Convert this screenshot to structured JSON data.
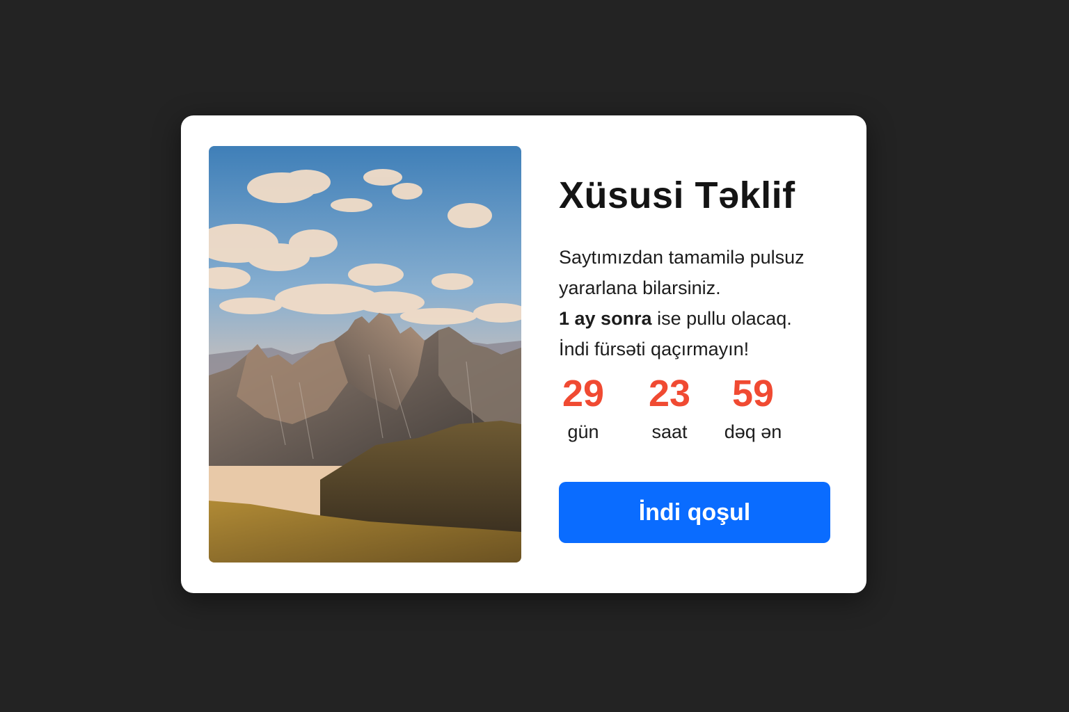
{
  "offer": {
    "title": "Xüsusi Təklif",
    "desc_line1": "Saytımızdan tamamilə pulsuz",
    "desc_line2": "yararlana bilarsiniz.",
    "desc_line3_bold": "1 ay sonra",
    "desc_line3_rest": " ise pullu olacaq.",
    "desc_line4": "İndi fürsəti qaçırmayın!",
    "countdown": [
      {
        "value": "29",
        "label": "gün"
      },
      {
        "value": "23",
        "label": "saat"
      },
      {
        "value": "59",
        "label": "dəq ən"
      }
    ],
    "cta_label": "İndi qoşul"
  },
  "image": {
    "subject": "mountain-landscape"
  },
  "colors": {
    "background": "#232323",
    "card": "#ffffff",
    "countdown": "#f04a32",
    "button": "#0a6cff"
  }
}
